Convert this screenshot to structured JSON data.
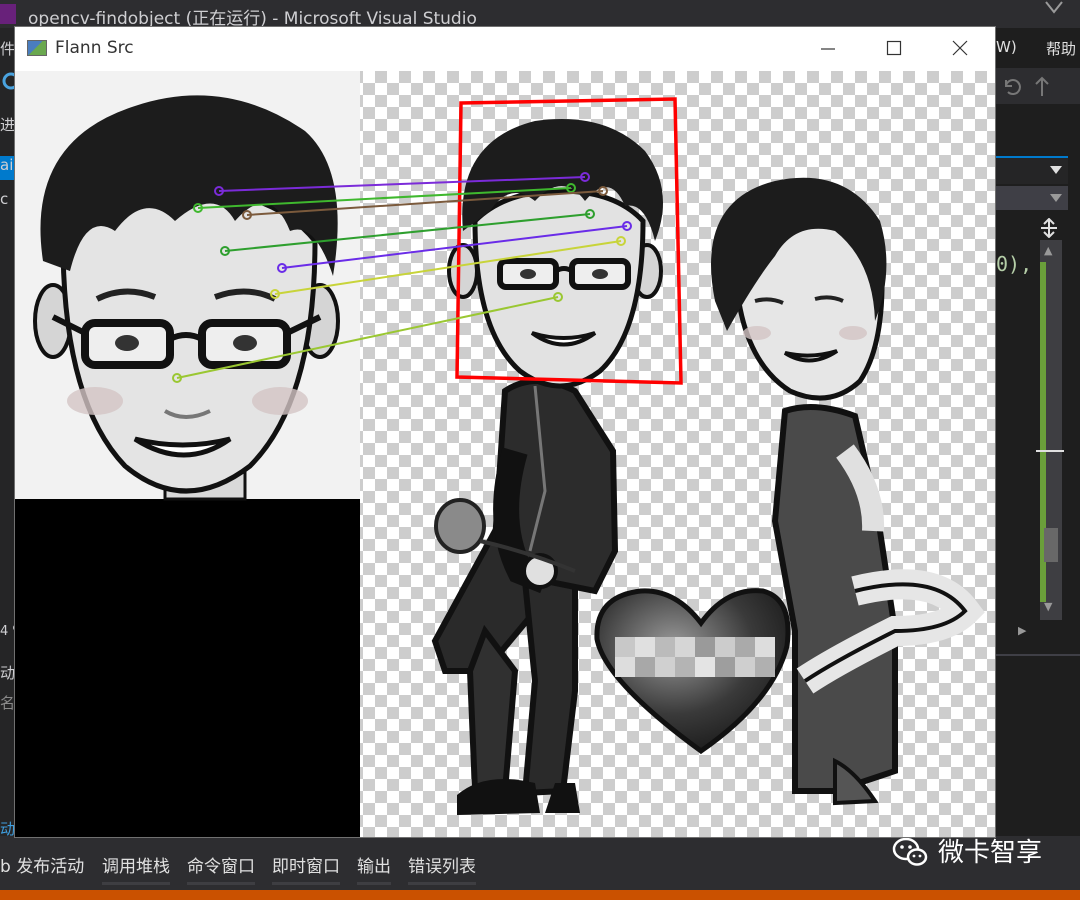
{
  "vs": {
    "title": "opencv-findobject (正在运行) - Microsoft Visual Studio",
    "menu_window_fragment": "W)",
    "menu_help": "帮助",
    "left_fragments": [
      "件",
      "进",
      "ai",
      "c",
      "4 %",
      "动",
      "名",
      "动"
    ],
    "code_fragment": "0),",
    "bottom_tabs": [
      "b 发布活动",
      "调用堆栈",
      "命令窗口",
      "即时窗口",
      "输出",
      "错误列表"
    ]
  },
  "cv_window": {
    "title": "Flann Src",
    "controls": [
      "minimize",
      "maximize",
      "close"
    ]
  },
  "watermark": {
    "icon": "wechat-icon",
    "text": "微卡智享"
  },
  "colors": {
    "vs_bg": "#2d2d30",
    "status_bar": "#ca5100",
    "detection_box": "#ff0000",
    "match_lines": [
      "#7b2bd9",
      "#3fb82e",
      "#7b5a3c",
      "#2e9f2e",
      "#6a2ce8",
      "#c8d43a",
      "#9ac732"
    ]
  }
}
